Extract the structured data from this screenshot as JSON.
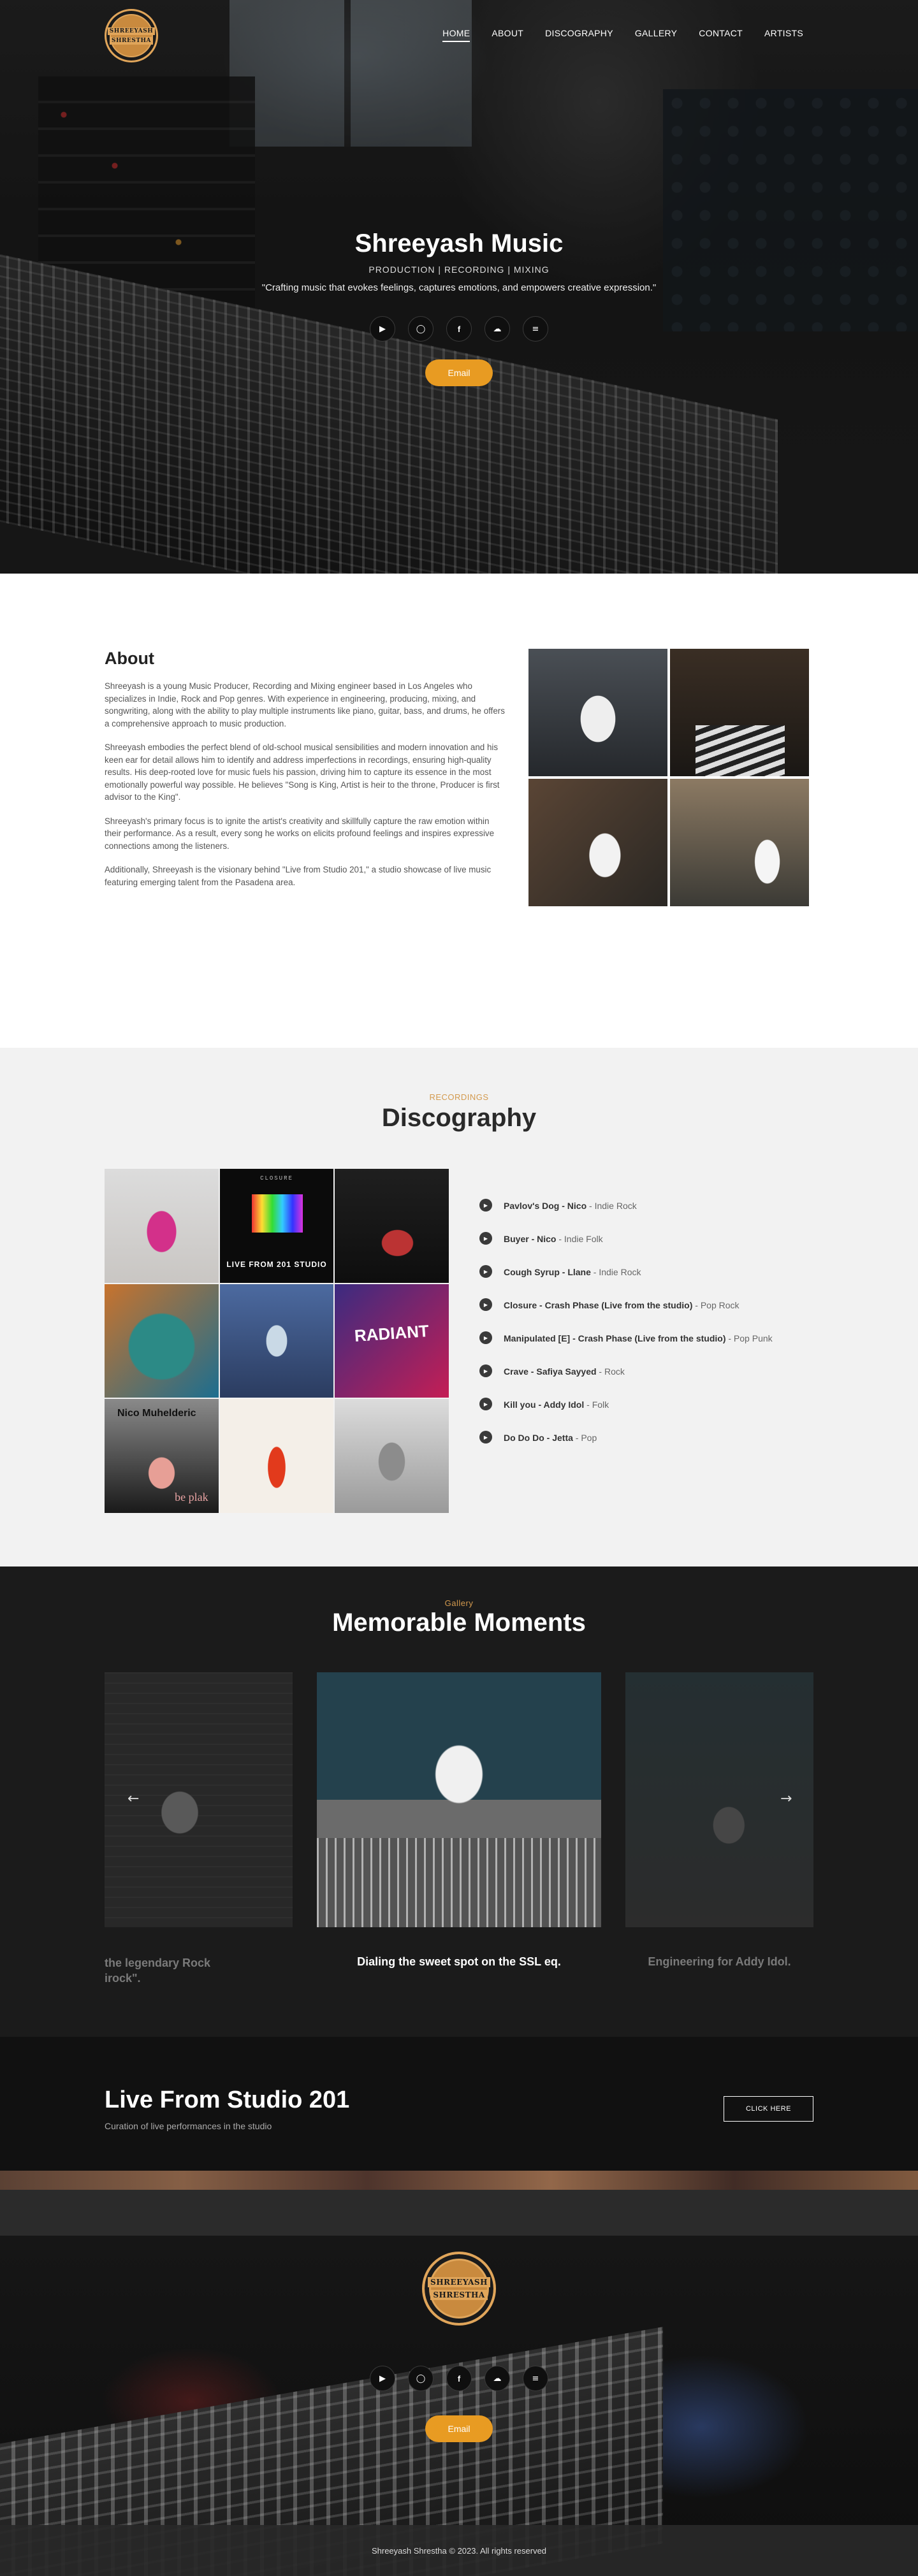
{
  "nav": {
    "logo_line1": "SHREEYASH",
    "logo_line2": "SHRESTHA",
    "links": [
      {
        "label": "HOME",
        "active": true
      },
      {
        "label": "ABOUT"
      },
      {
        "label": "DISCOGRAPHY"
      },
      {
        "label": "GALLERY"
      },
      {
        "label": "CONTACT"
      },
      {
        "label": "ARTISTS"
      }
    ]
  },
  "hero": {
    "title": "Shreeyash Music",
    "subtitle": "PRODUCTION | RECORDING | MIXING",
    "quote": "\"Crafting music that evokes feelings, captures emotions, and empowers creative expression.\"",
    "socials": [
      "youtube-icon",
      "instagram-icon",
      "facebook-icon",
      "soundcloud-icon",
      "spotify-icon"
    ],
    "email_label": "Email"
  },
  "about": {
    "heading": "About",
    "paragraphs": [
      "Shreeyash is a young Music Producer, Recording and Mixing engineer based in Los Angeles who specializes in Indie, Rock and Pop genres. With experience in engineering, producing, mixing, and songwriting, along with the ability to play multiple instruments like piano, guitar, bass, and drums, he offers a comprehensive approach to music production.",
      "Shreeyash embodies the perfect blend of old-school musical sensibilities and modern innovation and his keen ear for detail allows him to identify and address imperfections in recordings, ensuring high-quality results.  His deep-rooted love for music fuels his passion, driving him to capture its essence in the most emotionally powerful way possible. He believes \"Song is King, Artist is heir to the throne, Producer is first advisor to the King\".",
      "Shreeyash's primary focus is to ignite the artist's creativity and skillfully capture the raw emotion within their performance. As a result, every song he works on elicits profound feelings and inspires expressive connections among the listeners.",
      "Additionally, Shreeyash is the visionary behind \"Live from Studio 201,\" a studio showcase of live music featuring emerging talent from the Pasadena area."
    ]
  },
  "discography": {
    "eyebrow": "RECORDINGS",
    "title": "Discography",
    "album_texts": {
      "live_top": "CLOSURE",
      "live_title": "LIVE FROM 201 STUDIO",
      "radiant": "RADIANT",
      "nico": "Nico Muhelderic",
      "nico_sub": "be plak"
    },
    "tracks": [
      {
        "title": "Pavlov's Dog - Nico",
        "genre": " - Indie Rock"
      },
      {
        "title": "Buyer - Nico",
        "genre": " - Indie Folk"
      },
      {
        "title": "Cough Syrup - Llane",
        "genre": " - Indie Rock"
      },
      {
        "title": "Closure - Crash Phase (Live from the studio)",
        "genre": " - Pop Rock"
      },
      {
        "title": "Manipulated [E] - Crash Phase (Live from the studio)",
        "genre": " - Pop Punk"
      },
      {
        "title": "Crave - Safiya Sayyed",
        "genre": " - Rock"
      },
      {
        "title": "Kill you - Addy Idol",
        "genre": " - Folk"
      },
      {
        "title": "Do Do Do - Jetta",
        "genre": " - Pop"
      }
    ]
  },
  "gallery": {
    "eyebrow": "Gallery",
    "title": "Memorable Moments",
    "captions": [
      "the legendary Rock\nirock\".",
      "Dialing the sweet spot on the SSL eq.",
      "Engineering for Addy Idol."
    ],
    "prev": "←",
    "next": "→"
  },
  "live": {
    "title": "Live From Studio 201",
    "subtitle": "Curation of live performances in the studio",
    "button": "CLICK HERE"
  },
  "footer": {
    "email_label": "Email",
    "copyright": "Shreeyash Shrestha © 2023. All rights reserved"
  }
}
